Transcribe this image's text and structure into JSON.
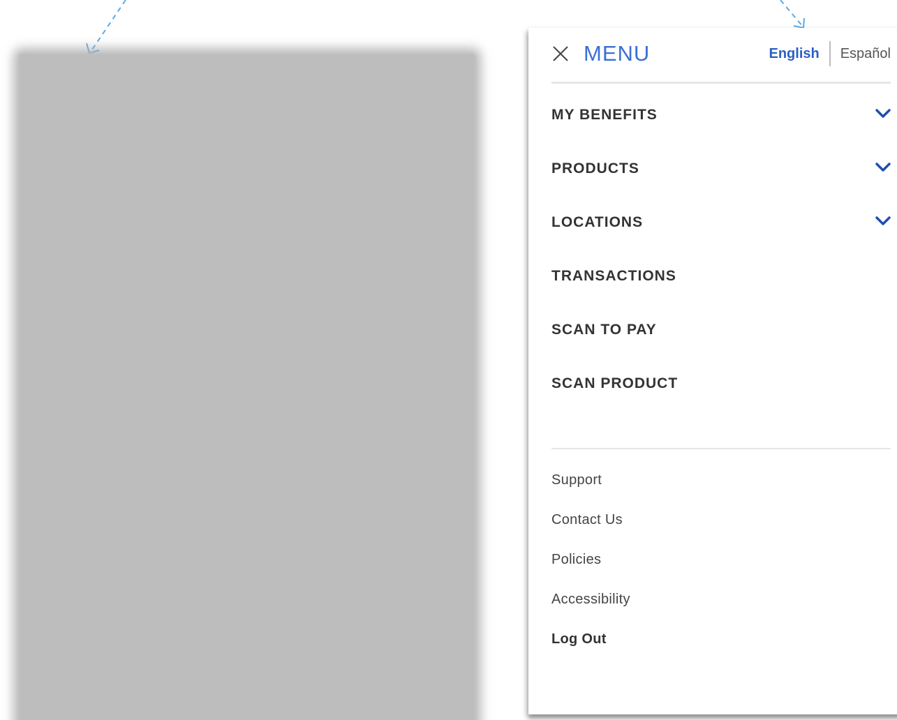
{
  "menu": {
    "title": "MENU",
    "close_icon": "close-icon",
    "languages": {
      "active": "English",
      "other": "Español"
    },
    "nav_items": [
      {
        "label": "MY BENEFITS",
        "expandable": true
      },
      {
        "label": "PRODUCTS",
        "expandable": true
      },
      {
        "label": "LOCATIONS",
        "expandable": true
      },
      {
        "label": "TRANSACTIONS",
        "expandable": false
      },
      {
        "label": "SCAN TO PAY",
        "expandable": false
      },
      {
        "label": "SCAN PRODUCT",
        "expandable": false
      }
    ],
    "footer_links": [
      {
        "label": "Support"
      },
      {
        "label": "Contact Us"
      },
      {
        "label": "Policies"
      },
      {
        "label": "Accessibility"
      },
      {
        "label": "Log Out"
      }
    ]
  },
  "colors": {
    "accent": "#2a5fc4",
    "menu_title": "#3c6fd6",
    "chevron": "#1f4fae",
    "annotation": "#5aa9e6",
    "placeholder": "#bdbdbd"
  }
}
